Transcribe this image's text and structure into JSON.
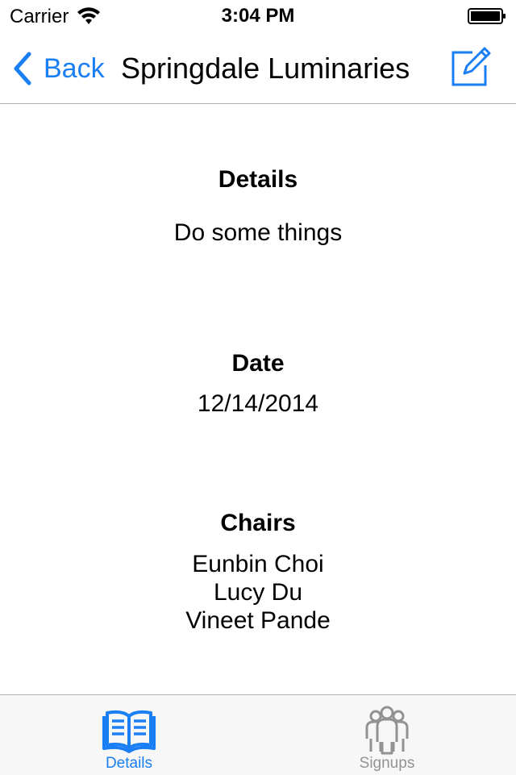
{
  "status_bar": {
    "carrier": "Carrier",
    "time": "3:04 PM",
    "wifi_icon": "wifi-icon",
    "battery_icon": "battery-icon"
  },
  "nav": {
    "back_label": "Back",
    "title": "Springdale Luminaries",
    "edit_icon": "edit-icon",
    "accent_color": "#1a7ef4"
  },
  "content": {
    "details": {
      "heading": "Details",
      "value": "Do some things"
    },
    "date": {
      "heading": "Date",
      "value": "12/14/2014"
    },
    "chairs": {
      "heading": "Chairs",
      "names": [
        "Eunbin Choi",
        "Lucy Du",
        "Vineet Pande"
      ]
    }
  },
  "tab_bar": {
    "tabs": [
      {
        "label": "Details",
        "icon": "book-icon",
        "selected": true,
        "color": "#1a7ef4"
      },
      {
        "label": "Signups",
        "icon": "people-icon",
        "selected": false,
        "color": "#929292"
      }
    ]
  }
}
